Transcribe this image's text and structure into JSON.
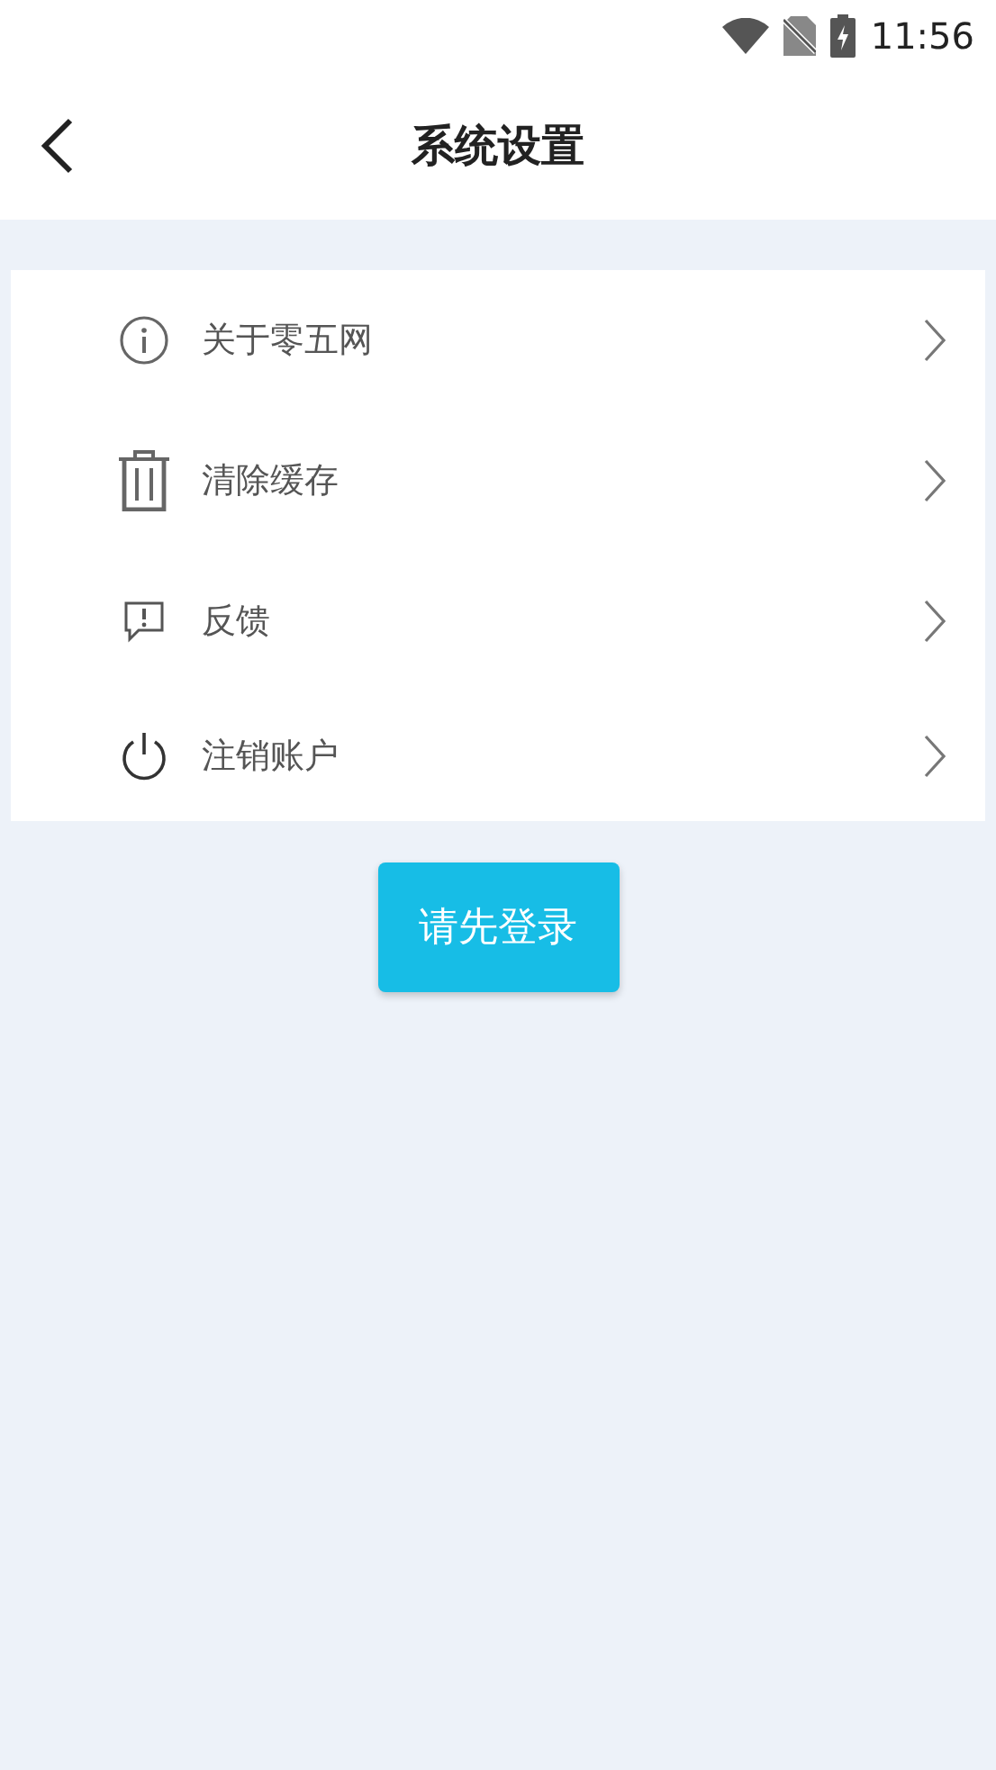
{
  "status_bar": {
    "time": "11:56"
  },
  "header": {
    "title": "系统设置"
  },
  "menu": [
    {
      "label": "关于零五网",
      "kind": "info"
    },
    {
      "label": "清除缓存",
      "kind": "trash"
    },
    {
      "label": "反馈",
      "kind": "feedback"
    },
    {
      "label": "注销账户",
      "kind": "power"
    }
  ],
  "login_button": {
    "label": "请先登录"
  }
}
